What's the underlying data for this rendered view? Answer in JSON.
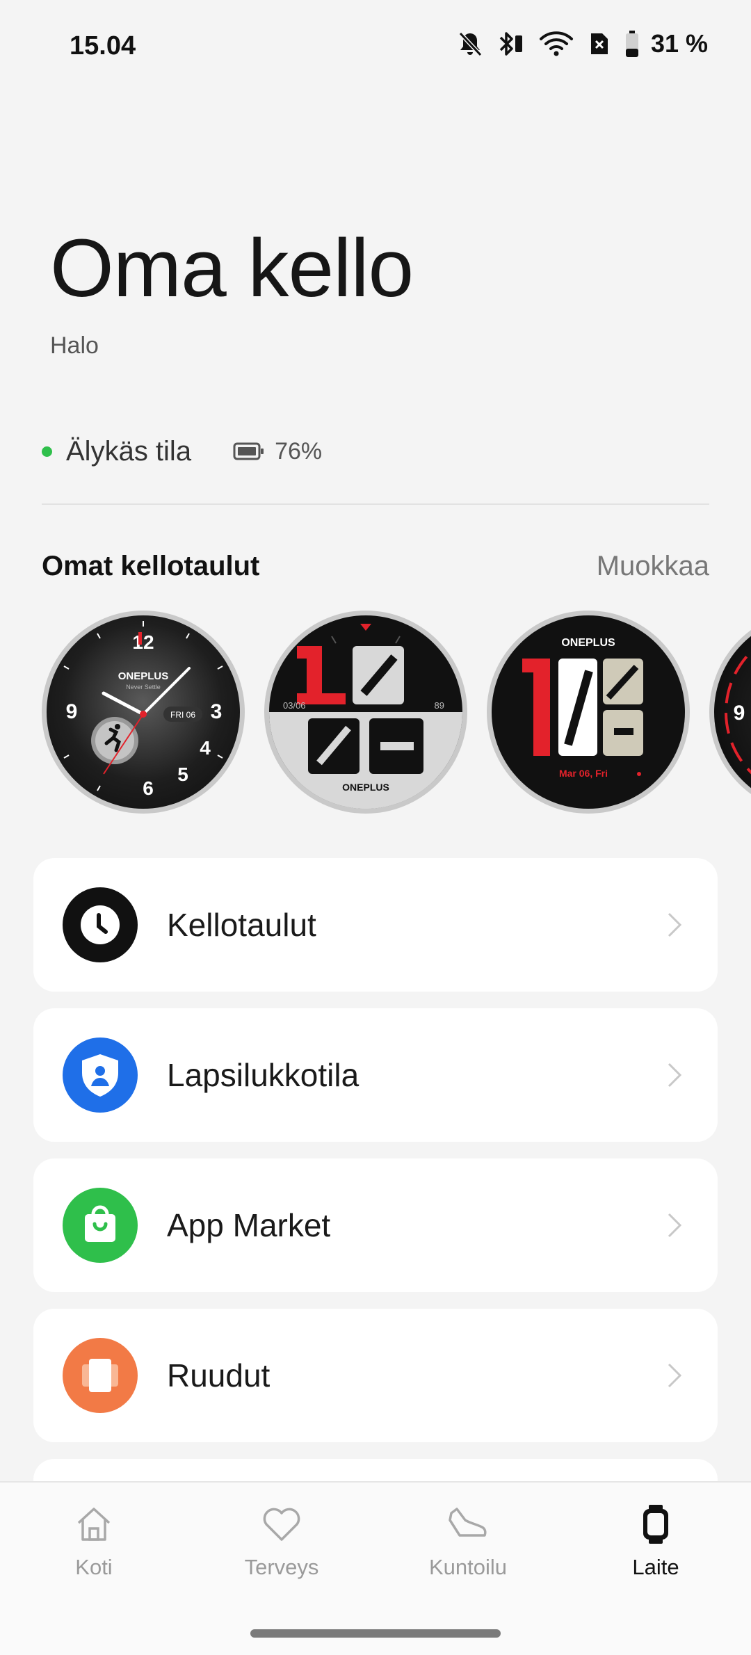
{
  "status_bar": {
    "time": "15.04",
    "battery_percent": "31 %",
    "icons": [
      "bell-off-icon",
      "bluetooth-icon",
      "wifi-icon",
      "sim-off-icon",
      "battery-icon"
    ]
  },
  "header": {
    "title": "Oma kello",
    "subtitle": "Halo"
  },
  "watch_status": {
    "mode_label": "Älykäs tila",
    "battery": "76%",
    "dot_color": "#2fbf4b"
  },
  "faces_section": {
    "title": "Omat kellotaulut",
    "action": "Muokkaa",
    "faces": [
      {
        "brand": "ONEPLUS",
        "tagline": "Never Settle",
        "n12": "12",
        "n9": "9",
        "n3": "3",
        "n4": "4",
        "n5": "5",
        "n6": "6",
        "date": "FRI 06"
      },
      {
        "date": "03/06",
        "heart": "89",
        "brand": "ONEPLUS",
        "hour": "10",
        "minute": "03"
      },
      {
        "brand": "ONEPLUS",
        "hour": "10",
        "minute": "03",
        "date": "Mar 06, Fri"
      },
      {
        "n9": "9"
      }
    ]
  },
  "menu": [
    {
      "label": "Kellotaulut",
      "icon": "clock-icon",
      "color": "#111111"
    },
    {
      "label": "Lapsilukkotila",
      "icon": "shield-user-icon",
      "color": "#1f6fe8"
    },
    {
      "label": "App Market",
      "icon": "shopping-bag-icon",
      "color": "#2fbf4b"
    },
    {
      "label": "Ruudut",
      "icon": "cards-icon",
      "color": "#f27a46"
    }
  ],
  "bottom_nav": {
    "items": [
      {
        "label": "Koti",
        "icon": "home-icon",
        "active": false
      },
      {
        "label": "Terveys",
        "icon": "heart-icon",
        "active": false
      },
      {
        "label": "Kuntoilu",
        "icon": "shoe-icon",
        "active": false
      },
      {
        "label": "Laite",
        "icon": "watch-icon",
        "active": true
      }
    ]
  }
}
